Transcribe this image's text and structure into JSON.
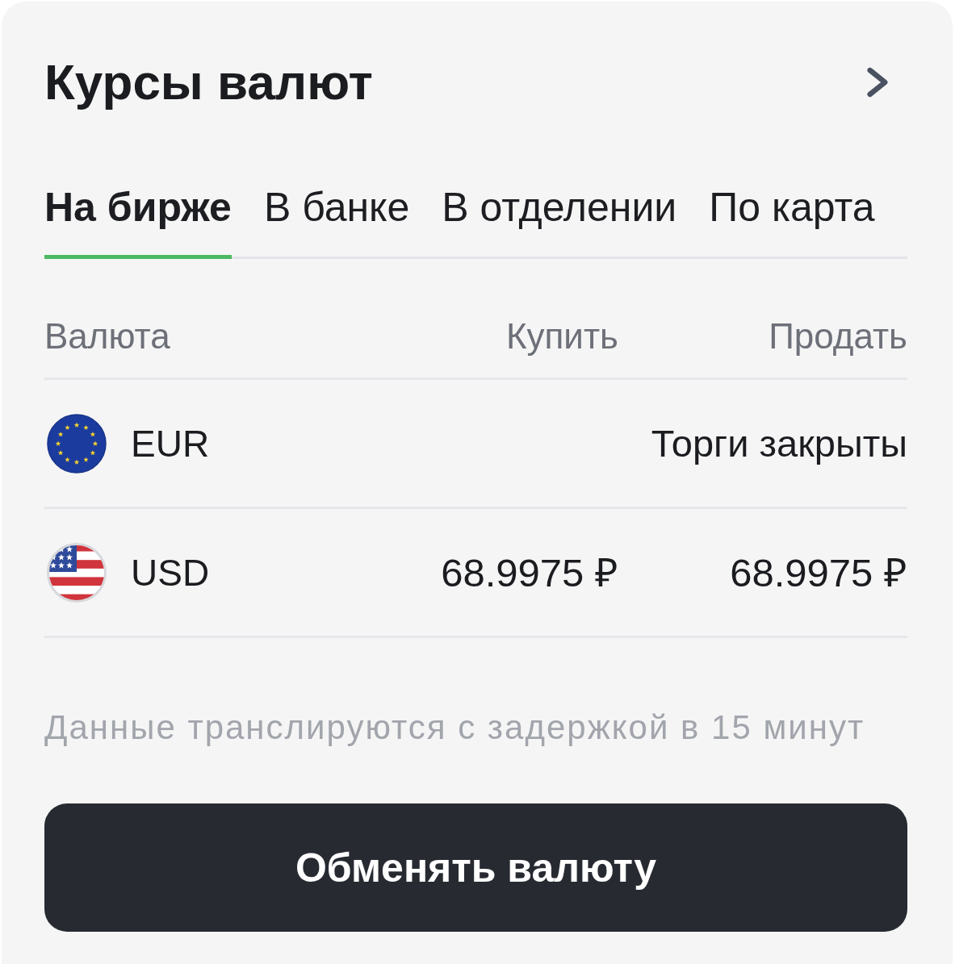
{
  "header": {
    "title": "Курсы валют"
  },
  "tabs": [
    {
      "label": "На бирже",
      "selected": true
    },
    {
      "label": "В банке",
      "selected": false
    },
    {
      "label": "В отделении",
      "selected": false
    },
    {
      "label": "По карта",
      "selected": false
    }
  ],
  "table": {
    "columns": [
      "Валюта",
      "Купить",
      "Продать"
    ],
    "rows": [
      {
        "kind": "closed",
        "currency": "EUR",
        "status": "Торги закрыты"
      },
      {
        "kind": "quoted",
        "currency": "USD",
        "buy": "68.9975 ₽",
        "sell": "68.9975 ₽"
      }
    ]
  },
  "note": "Данные транслируются с задержкой в 15 минут",
  "button": {
    "label": "Обменять валюту"
  }
}
